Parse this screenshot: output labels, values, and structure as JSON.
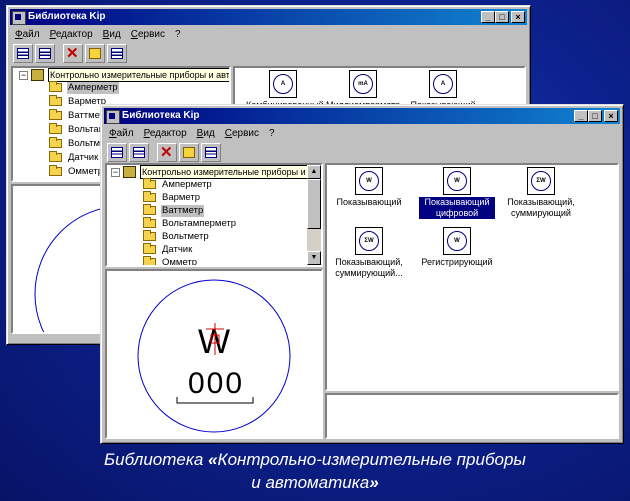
{
  "window_back": {
    "title": "Библиотека Kip",
    "menu": [
      "Файл",
      "Редактор",
      "Вид",
      "Сервис",
      "?"
    ],
    "tree_root": "Контрольно измерительные приборы и автоматика",
    "tree_items": [
      "Амперметр",
      "Варметр",
      "Ваттметр",
      "Вольтам",
      "Вольтм",
      "Датчик",
      "Омметр"
    ],
    "devices": [
      {
        "symbol": "A",
        "label": "Комбинированный"
      },
      {
        "symbol": "mA",
        "label": "Миллиамперметр"
      },
      {
        "symbol": "A",
        "label": "Показывающий"
      }
    ]
  },
  "window_front": {
    "title": "Библиотека Kip",
    "menu": [
      "Файл",
      "Редактор",
      "Вид",
      "Сервис",
      "?"
    ],
    "tree_root": "Контрольно измерительные приборы и автоматика",
    "tree_items": [
      "Амперметр",
      "Варметр",
      "Ваттметр",
      "Вольтамперметр",
      "Вольтметр",
      "Датчик",
      "Омметр"
    ],
    "selected_item": "Ваттметр",
    "devices": [
      {
        "symbol": "W",
        "label": "Показывающий"
      },
      {
        "symbol": "W",
        "label": "Показывающий цифровой",
        "selected": true
      },
      {
        "symbol": "ΣW",
        "label": "Показывающий, суммирующий"
      },
      {
        "symbol": "ΣW",
        "label": "Показывающий, суммирующий..."
      },
      {
        "symbol": "W",
        "label": "Регистрирующий"
      }
    ],
    "preview": {
      "unit": "W",
      "digits": "000"
    }
  },
  "window_buttons": {
    "minimize": "_",
    "maximize": "□",
    "close": "×"
  },
  "caption": {
    "line1_prefix": "Библиотека ",
    "quote_open": "«",
    "line1_rest": "Контрольно-измерительные приборы",
    "line2": "и автоматика",
    "quote_close": "»"
  },
  "colors": {
    "titlebar": "#000080",
    "background": "#0d2290",
    "selection": "#000080"
  }
}
